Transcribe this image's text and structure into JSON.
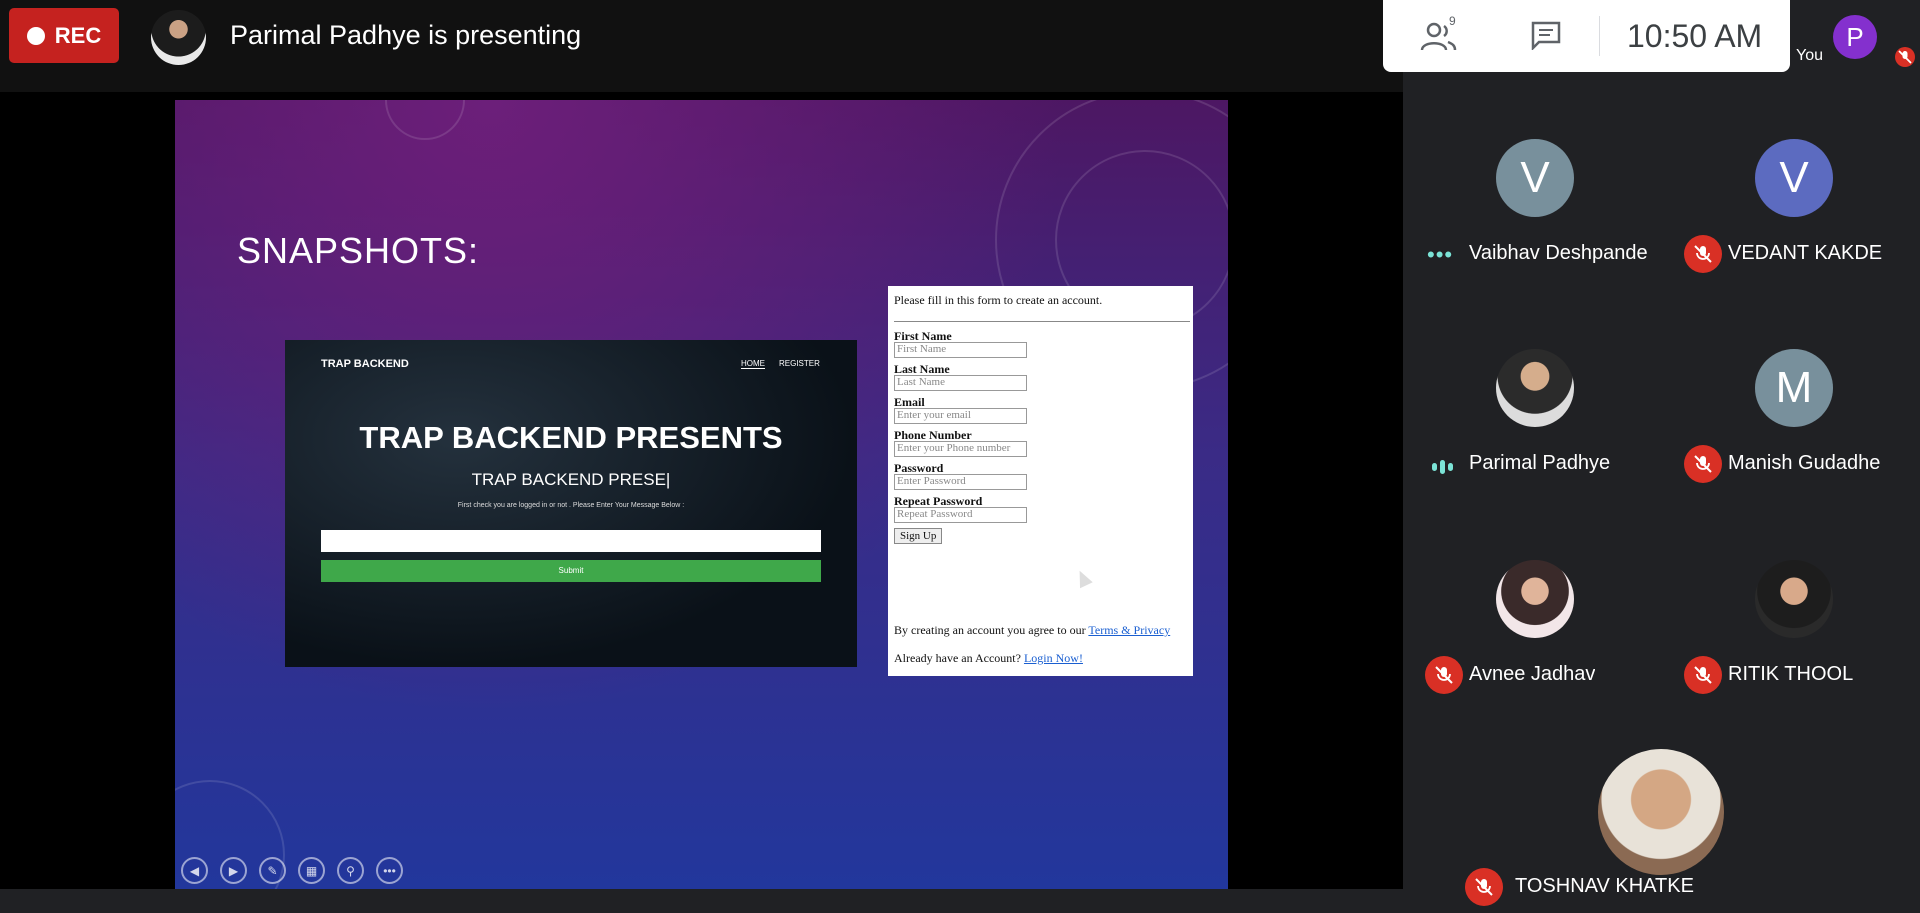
{
  "header": {
    "rec_label": "REC",
    "presenting_text": "Parimal Padhye is presenting"
  },
  "slide": {
    "title": "SNAPSHOTS:",
    "shot1": {
      "brand": "TRAP BACKEND",
      "nav_home": "HOME",
      "nav_register": "REGISTER",
      "heading": "TRAP BACKEND PRESENTS",
      "subheading": "TRAP BACKEND PRESE|",
      "note": "First check you are logged in or not . Please Enter Your Message Below :",
      "submit_label": "Submit"
    },
    "shot2": {
      "intro": "Please fill in this form to create an account.",
      "fields": [
        {
          "label": "First Name",
          "placeholder": "First Name"
        },
        {
          "label": "Last Name",
          "placeholder": "Last Name"
        },
        {
          "label": "Email",
          "placeholder": "Enter your email"
        },
        {
          "label": "Phone Number",
          "placeholder": "Enter your Phone number"
        },
        {
          "label": "Password",
          "placeholder": "Enter Password"
        },
        {
          "label": "Repeat Password",
          "placeholder": "Repeat Password"
        }
      ],
      "signup_label": "Sign Up",
      "terms_text": "By creating an account you agree to our",
      "terms_link": "Terms & Privacy",
      "login_text": "Already have an Account?",
      "login_link": "Login Now!"
    },
    "controls": [
      "◀",
      "▶",
      "✎",
      "▦",
      "⚲",
      "•••"
    ]
  },
  "toolbar": {
    "people_count": "9",
    "time": "10:50 AM",
    "self_initial": "P",
    "self_label": "You"
  },
  "participants": [
    {
      "name": "Vaibhav Deshpande",
      "initial": "V",
      "color": "#78909c",
      "status": "speaking-dots"
    },
    {
      "name": "VEDANT KAKDE",
      "initial": "V",
      "color": "#5c6bc0",
      "status": "muted"
    },
    {
      "name": "Parimal Padhye",
      "initial": "",
      "color": "#444",
      "status": "speaking-bars"
    },
    {
      "name": "Manish Gudadhe",
      "initial": "M",
      "color": "#78909c",
      "status": "muted"
    },
    {
      "name": "Avnee Jadhav",
      "initial": "",
      "color": "#444",
      "status": "muted"
    },
    {
      "name": "RITIK THOOL",
      "initial": "",
      "color": "#444",
      "status": "muted"
    },
    {
      "name": "TOSHNAV KHATKE",
      "initial": "",
      "color": "#444",
      "status": "muted"
    }
  ],
  "colors": {
    "rec_red": "#c5221f",
    "mute_red": "#d93025",
    "speaking_teal": "#7be3d6",
    "self_purple": "#8430ce"
  }
}
